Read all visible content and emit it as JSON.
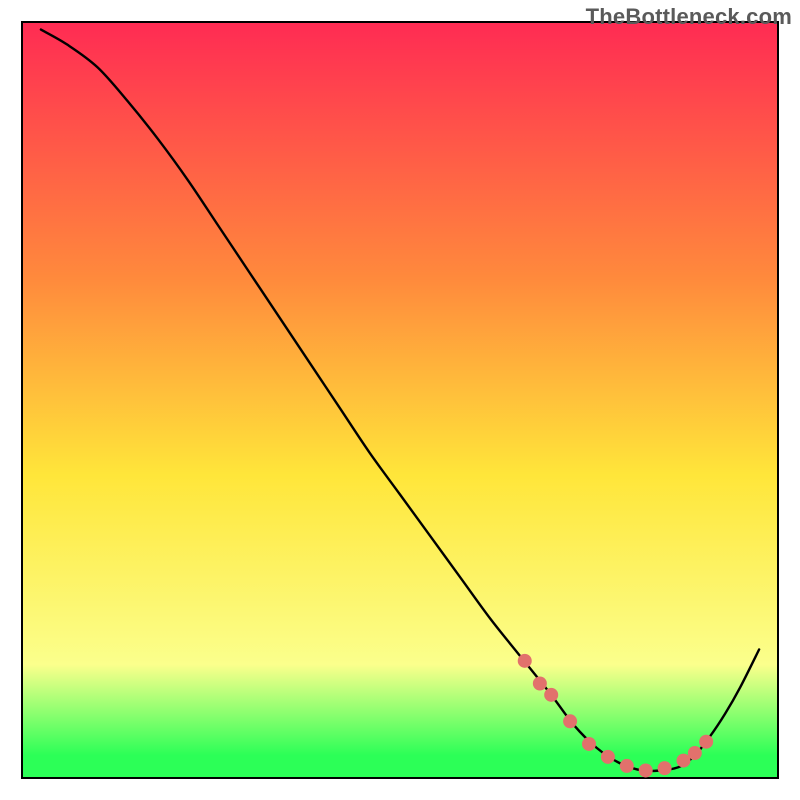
{
  "watermark": "TheBottleneck.com",
  "colors": {
    "gradient_top": "#ff2b53",
    "gradient_mid_high": "#ff8a3c",
    "gradient_mid": "#ffe63a",
    "gradient_low": "#fbff8c",
    "gradient_bottom": "#2cff57",
    "curve": "#000000",
    "marker": "#e2716c",
    "frame": "#000000"
  },
  "chart_data": {
    "type": "line",
    "title": "",
    "xlabel": "",
    "ylabel": "",
    "xlim": [
      0,
      100
    ],
    "ylim": [
      0,
      100
    ],
    "series": [
      {
        "name": "bottleneck-curve",
        "x": [
          2.5,
          6,
          10,
          14,
          18,
          22,
          26,
          30,
          34,
          38,
          42,
          46,
          50,
          54,
          58,
          62,
          66,
          70,
          73,
          76,
          79,
          82,
          84.5,
          87,
          89,
          91,
          93,
          95,
          97.5
        ],
        "y": [
          99,
          97,
          94,
          89.5,
          84.5,
          79,
          73,
          67,
          61,
          55,
          49,
          43,
          37.5,
          32,
          26.5,
          21,
          16,
          11,
          7,
          4,
          2,
          1,
          1,
          1.5,
          3,
          5.5,
          8.5,
          12,
          17
        ],
        "mode": "spline",
        "stroke": "#000000"
      }
    ],
    "markers": {
      "name": "highlighted-range",
      "x": [
        66.5,
        68.5,
        70,
        72.5,
        75,
        77.5,
        80,
        82.5,
        85,
        87.5,
        89,
        90.5
      ],
      "y": [
        15.5,
        12.5,
        11,
        7.5,
        4.5,
        2.8,
        1.6,
        1.0,
        1.3,
        2.3,
        3.3,
        4.8
      ],
      "color": "#e2716c",
      "radius": 7
    },
    "background": {
      "type": "vertical-gradient",
      "legend_meaning": "red = severe bottleneck, green = balanced",
      "stops": [
        {
          "offset": 0.0,
          "color": "#ff2b53"
        },
        {
          "offset": 0.34,
          "color": "#ff8a3c"
        },
        {
          "offset": 0.6,
          "color": "#ffe63a"
        },
        {
          "offset": 0.85,
          "color": "#fbff8c"
        },
        {
          "offset": 0.97,
          "color": "#2cff57"
        },
        {
          "offset": 1.0,
          "color": "#2cff57"
        }
      ]
    }
  }
}
